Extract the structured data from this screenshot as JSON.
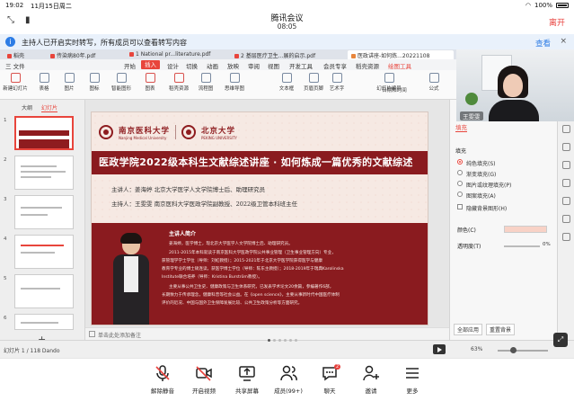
{
  "status_bar": {
    "time": "19:02",
    "date": "11月15日周二",
    "battery": "100%"
  },
  "meeting": {
    "title": "腾讯会议",
    "timer": "08:05",
    "leave_label": "离开"
  },
  "notice": {
    "message": "主持人已开启实时转写，所有成员可以查看转写内容",
    "view_label": "查看",
    "close_label": "×"
  },
  "wps": {
    "tabs": [
      {
        "label": "稻壳"
      },
      {
        "label": "传染病80年.pdf"
      },
      {
        "label": "1 National pr...literature.pdf"
      },
      {
        "label": "2 基层医疗卫生...展的启示.pdf"
      },
      {
        "label": "医政讲座-如何炼...20221108"
      }
    ],
    "menu": [
      {
        "label": "三 文件"
      },
      {
        "label": "开始"
      },
      {
        "label": "插入"
      },
      {
        "label": "设计"
      },
      {
        "label": "切换"
      },
      {
        "label": "动画"
      },
      {
        "label": "放映"
      },
      {
        "label": "审阅"
      },
      {
        "label": "视图"
      },
      {
        "label": "开发工具"
      },
      {
        "label": "会员专享"
      },
      {
        "label": "稻壳资源"
      },
      {
        "label": "绘图工具"
      }
    ],
    "menu_active": "插入",
    "tools": [
      {
        "label": "新建幻灯片"
      },
      {
        "label": "表格"
      },
      {
        "label": "图片"
      },
      {
        "label": "图标"
      },
      {
        "label": "智能图形"
      },
      {
        "label": "图表"
      },
      {
        "label": "稻壳资源"
      },
      {
        "label": "流程图"
      },
      {
        "label": "思维导图"
      },
      {
        "label": "文本框"
      },
      {
        "label": "艺术字"
      },
      {
        "label": "页眉页脚"
      },
      {
        "label": "幻灯片编号"
      },
      {
        "label": "日期和时间"
      },
      {
        "label": "公式"
      }
    ],
    "thumb_tabs": {
      "outline": "大纲",
      "slides": "幻灯片"
    },
    "thumbnails": [
      "1",
      "2",
      "3",
      "4",
      "5",
      "6"
    ],
    "notes_placeholder": "单击此处添加备注",
    "status_left": "幻灯片 1 / 118   Dando",
    "zoom": "63%",
    "slide": {
      "logo_left_cn": "南京医科大学",
      "logo_left_en": "Nanjing Medical University",
      "logo_right_cn": "北京大学",
      "logo_right_en": "PEKING UNIVERSITY",
      "title": "医政学院2022级本科生文献综述讲座 · 如何炼成一篇优秀的文献综述",
      "speaker": "主讲人：姜海婷 北京大学医学人文学院博士后、助理研究员",
      "host": "主持人：王雯雯 南京医科大学医政学院副教授、2022级卫管本科班主任",
      "bio_head": "主讲人简介",
      "bio_lines": [
        "姜海婷，医学博士，现北京大学医学人文学院博士后、助理研究员。",
        "2011-2015年本科就读于南京医科大学医政学院公共事业管理（卫生事业管理方向）专业，",
        "获管理学学士学位（导师：刘虹教授）；2015-2021年于北京大学医学院获得医学与健康",
        "教育学专业的博士硕连读，获医学博士学位（导师：陈东主教授）；2018-2019年于瑞典Karolinska",
        "Institute联合培养（导师：Kristina Burström教授）。",
        "主要从事公共卫生史、健康政策与卫生体系研究，已发表学术论文20余篇，参编著作6部，",
        "长期致力于传承理念，健康科普等社会公益。在《open science》，主要从事新时代中国医疗体制",
        "评价的近况、中国与国外卫生保障发展比较、公共卫生政策分析等方面研究。"
      ]
    },
    "props": {
      "tab_title": "填充",
      "section": "填充",
      "options": [
        {
          "label": "纯色填充(S)",
          "selected": true
        },
        {
          "label": "渐变填充(G)",
          "selected": false
        },
        {
          "label": "图片或纹理填充(P)",
          "selected": false
        },
        {
          "label": "图案填充(A)",
          "selected": false
        }
      ],
      "hide_bg_label": "隐藏背景图形(H)",
      "color_label": "颜色(C)",
      "transparency_label": "透明度(T)",
      "transparency_value": "0%",
      "apply_all": "全部应用",
      "reset_bg": "重置背景"
    }
  },
  "video": {
    "participant_name": "王雯雯"
  },
  "toolbar": [
    {
      "label": "解除静音",
      "icon": "mic-muted-icon"
    },
    {
      "label": "开启视频",
      "icon": "camera-off-icon"
    },
    {
      "label": "共享屏幕",
      "icon": "share-screen-icon"
    },
    {
      "label": "成员(99+)",
      "icon": "members-icon"
    },
    {
      "label": "聊天",
      "icon": "chat-icon",
      "badge": "2"
    },
    {
      "label": "邀请",
      "icon": "invite-icon"
    },
    {
      "label": "更多",
      "icon": "more-icon"
    }
  ],
  "colors": {
    "accent": "#e8413d",
    "link": "#2c7ce5",
    "slide_band": "#8a1b1f",
    "slide_bg": "#f6e9e3"
  }
}
